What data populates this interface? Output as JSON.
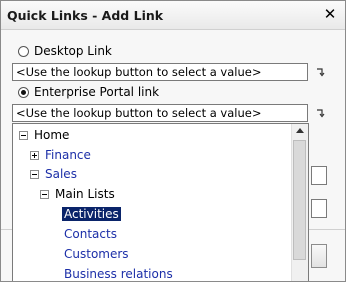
{
  "dialog": {
    "title": "Quick Links - Add Link",
    "close_glyph": "✕"
  },
  "options": {
    "desktop_link": {
      "label": "Desktop Link",
      "selected": false
    },
    "portal_link": {
      "label": "Enterprise Portal link",
      "selected": true
    }
  },
  "fields": {
    "desktop_value": "<Use the lookup button to select a value>",
    "portal_value": "<Use the lookup button to select a value>"
  },
  "icons": {
    "lookup": "lookup-arrow-icon"
  },
  "tree": {
    "items": [
      {
        "label": "Home",
        "level": 0,
        "toggle": "collapse"
      },
      {
        "label": "Finance",
        "level": 1,
        "toggle": "expand"
      },
      {
        "label": "Sales",
        "level": 1,
        "toggle": "collapse"
      },
      {
        "label": "Main Lists",
        "level": 2,
        "toggle": "collapse"
      },
      {
        "label": "Activities",
        "level": 3,
        "toggle": "none",
        "selected": true
      },
      {
        "label": "Contacts",
        "level": 3,
        "toggle": "none"
      },
      {
        "label": "Customers",
        "level": 3,
        "toggle": "none"
      },
      {
        "label": "Business relations",
        "level": 3,
        "toggle": "none"
      }
    ],
    "selection_color": "#0a246a",
    "link_color": "#1c2fa8"
  }
}
